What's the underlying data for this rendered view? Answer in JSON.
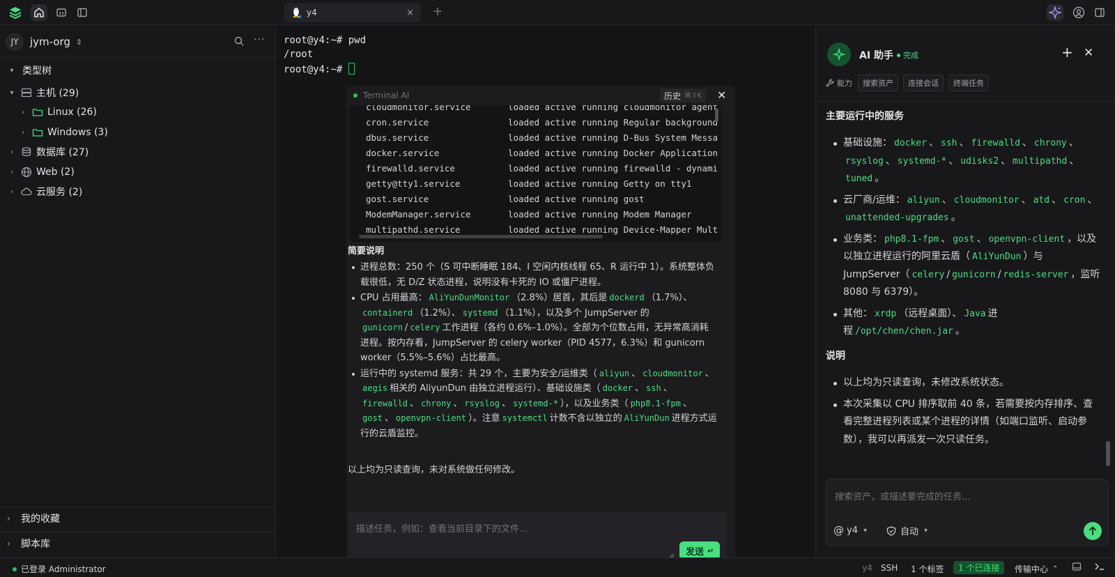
{
  "topbar": {
    "tab_title": "y4",
    "tab_close": "×",
    "new_tab": "+"
  },
  "sidebar": {
    "org_initials": "JY",
    "org_name": "jym-org",
    "tree_title": "类型树",
    "tree": [
      {
        "label": "主机 (29)",
        "icon": "server-icon"
      },
      {
        "label": "Linux (26)",
        "icon": "folder-icon"
      },
      {
        "label": "Windows (3)",
        "icon": "folder-icon"
      },
      {
        "label": "数据库 (27)",
        "icon": "database-icon"
      },
      {
        "label": "Web (2)",
        "icon": "globe-icon"
      },
      {
        "label": "云服务 (2)",
        "icon": "cloud-icon"
      }
    ],
    "favorites": "我的收藏",
    "scripts": "脚本库"
  },
  "terminal": {
    "lines": [
      "root@y4:~# pwd",
      "/root",
      "root@y4:~# "
    ]
  },
  "terminal_ai": {
    "title": "Terminal AI",
    "history_label": "历史",
    "history_shortcut": "⌘⇧K",
    "services": [
      {
        "name": "cloudmonitor.service",
        "desc": "loaded active running cloudmonitor agent"
      },
      {
        "name": "cron.service",
        "desc": "loaded active running Regular background"
      },
      {
        "name": "dbus.service",
        "desc": "loaded active running D-Bus System Messa"
      },
      {
        "name": "docker.service",
        "desc": "loaded active running Docker Application"
      },
      {
        "name": "firewalld.service",
        "desc": "loaded active running firewalld - dynami"
      },
      {
        "name": "getty@tty1.service",
        "desc": "loaded active running Getty on tty1"
      },
      {
        "name": "gost.service",
        "desc": "loaded active running gost"
      },
      {
        "name": "ModemManager.service",
        "desc": "loaded active running Modem Manager"
      },
      {
        "name": "multipathd.service",
        "desc": "loaded active running Device-Mapper Mult"
      }
    ],
    "summary_heading": "简要说明",
    "b1": "进程总数：250 个（S 可中断睡眠 184、I 空闲内核线程 65、R 运行中 1）。系统整体负载很低，无 D/Z 状态进程，说明没有卡死的 IO 或僵尸进程。",
    "b2": {
      "t1": "CPU 占用最高：",
      "c1": "AliYunDunMonitor",
      "t2": "（2.8%）居首，其后是",
      "c2": "dockerd",
      "t3": "（1.7%）、",
      "c3": "containerd",
      "t4": "（1.2%）、",
      "c4": "systemd",
      "t5": "（1.1%），以及多个 JumpServer 的",
      "c5": "gunicorn",
      "t6": "/",
      "c6": "celery",
      "t7": "工作进程（各约 0.6%–1.0%）。全部为个位数占用，无异常高消耗进程。按内存看，JumpServer 的 celery worker（PID 4577，6.3%）和 gunicorn worker（5.5%–5.6%）占比最高。"
    },
    "b3": {
      "t1": "运行中的 systemd 服务：共 29 个，主要为安全/运维类（",
      "c1": "aliyun",
      "t2": "、",
      "c2": "cloudmonitor",
      "t3": "、",
      "c3": "aegis",
      "t4": "相关的 AliyunDun 由独立进程运行）、基础设施类（",
      "c4": "docker",
      "t5": "、",
      "c5": "ssh",
      "t6": "、",
      "c6": "firewalld",
      "t7": "、",
      "c7": "chrony",
      "t8": "、",
      "c8": "rsyslog",
      "t9": "、",
      "c9": "systemd-*",
      "t10": "），以及业务类（",
      "c10": "php8.1-fpm",
      "t11": "、",
      "c11": "gost",
      "t12": "、",
      "c12": "openvpn-client",
      "t13": "）。注意",
      "c13": "systemctl",
      "t14": "计数不含以独立的",
      "c14": "AliYunDun",
      "t15": "进程方式运行的云盾监控。"
    },
    "note": "以上均为只读查询，未对系统做任何修改。",
    "input_placeholder": "描述任务，例如：查看当前目录下的文件...",
    "send_label": "发送",
    "send_key": "↵"
  },
  "ai_panel": {
    "title": "AI 助手",
    "status": "完成",
    "chips_label": "能力",
    "chips": [
      "搜索资产",
      "连接会话",
      "终端任务"
    ],
    "section1": "主要运行中的服务",
    "infra": {
      "label": "基础设施：",
      "items": [
        "docker",
        "ssh",
        "firewalld",
        "chrony",
        "rsyslog",
        "systemd-*",
        "udisks2",
        "multipathd",
        "tuned"
      ],
      "end": "。"
    },
    "cloud": {
      "label": "云厂商/运维：",
      "items": [
        "aliyun",
        "cloudmonitor",
        "atd",
        "cron",
        "unattended-upgrades"
      ],
      "end": "。"
    },
    "biz": {
      "label": "业务类：",
      "c1": "php8.1-fpm",
      "c2": "gost",
      "c3": "openvpn-client",
      "t1": "，以及以独立进程运行的阿里云盾（",
      "c4": "AliYunDun",
      "t2": "）与 JumpServer（",
      "c5": "celery",
      "c6": "gunicorn",
      "c7": "redis-server",
      "t3": "，监听 8080 与 6379）。"
    },
    "other": {
      "label": "其他：",
      "c1": "xrdp",
      "t1": "（远程桌面）、",
      "c2": "Java",
      "t2": "进程",
      "c3": "/opt/chen/chen.jar",
      "end": "。"
    },
    "section2": "说明",
    "note1": "以上均为只读查询，未修改系统状态。",
    "note2": "本次采集以 CPU 排序取前 40 条，若需要按内存排序、查看完整进程列表或某个进程的详情（如端口监听、启动参数），我可以再派发一次只读任务。",
    "input_placeholder": "搜索资产，或描述要完成的任务...",
    "target": "y4",
    "mode": "自动"
  },
  "statusbar": {
    "login": "已登录 Administrator",
    "host": "y4",
    "proto": "SSH",
    "tabs": "1 个标签",
    "connected": "1 个已连接",
    "transfer": "传输中心"
  }
}
